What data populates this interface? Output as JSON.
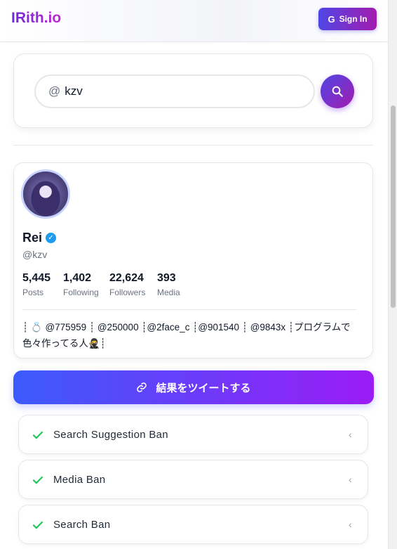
{
  "header": {
    "logo": "IRith.io",
    "signin_label": "Sign In",
    "google_icon": "G"
  },
  "search": {
    "prefix": "@",
    "value": "kzv"
  },
  "profile": {
    "name": "Rei",
    "handle": "@kzv",
    "stats": [
      {
        "value": "5,445",
        "label": "Posts"
      },
      {
        "value": "1,402",
        "label": "Following"
      },
      {
        "value": "22,624",
        "label": "Followers"
      },
      {
        "value": "393",
        "label": "Media"
      }
    ],
    "bio": "┊ 💍 @775959 ┊ @250000 ┊@2face_c ┊@901540 ┊ @9843x ┊プログラムで色々作ってる人🥷┊"
  },
  "tweet_button": {
    "label": "結果をツイートする"
  },
  "ban_checks": [
    {
      "label": "Search Suggestion Ban",
      "status": "ok"
    },
    {
      "label": "Media Ban",
      "status": "ok"
    },
    {
      "label": "Search Ban",
      "status": "ok"
    }
  ],
  "colors": {
    "accent_start": "#4f46e5",
    "accent_end": "#a21caf",
    "check": "#22c55e",
    "verified": "#1d9bf0"
  }
}
